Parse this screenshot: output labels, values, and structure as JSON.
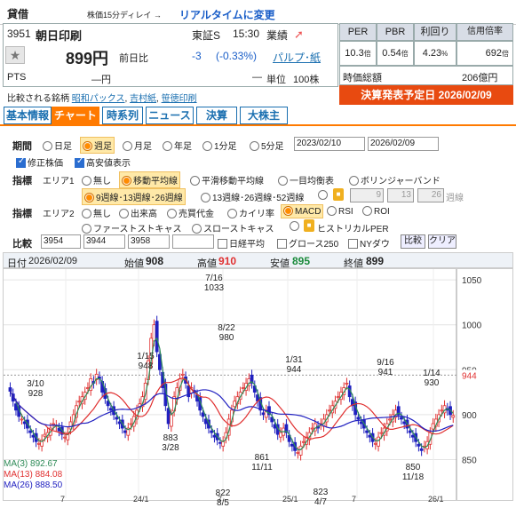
{
  "header": {
    "category": "貸借",
    "delay_note": "株価15分ディレイ →",
    "realtime_link": "リアルタイムに変更"
  },
  "stock": {
    "code": "3951",
    "name": "朝日印刷",
    "market": "東証S",
    "time": "15:30",
    "sector": "業績",
    "sector_link": "パルプ･紙",
    "price": "899円",
    "prev_label": "前日比",
    "change": "-3",
    "change_pct": "(-0.33%)",
    "pts_label": "PTS",
    "pts_value": "―円",
    "pts_change": "―",
    "unit_label": "単位",
    "unit_value": "100株"
  },
  "ratios": {
    "per_label": "PER",
    "per": "10.3",
    "per_unit": "倍",
    "pbr_label": "PBR",
    "pbr": "0.54",
    "pbr_unit": "倍",
    "yield_label": "利回り",
    "yield": "4.23",
    "yield_unit": "%",
    "margin_label": "信用倍率",
    "margin": "692",
    "margin_unit": "倍",
    "cap_label": "時価総額",
    "cap": "206億円",
    "earnings": "決算発表予定日 2026/02/09"
  },
  "compare": {
    "label": "比較される銘柄",
    "links": [
      "昭和パックス",
      "吉村紙",
      "笹徳印刷"
    ]
  },
  "tabs": [
    "基本情報",
    "チャート",
    "時系列",
    "ニュース",
    "決算",
    "大株主"
  ],
  "controls": {
    "period_label": "期間",
    "periods": [
      "日足",
      "週足",
      "月足",
      "年足",
      "1分足",
      "5分足"
    ],
    "date_from": "2023/02/10",
    "date_to": "2026/02/09",
    "adj_label": "修正株価",
    "hl_label": "高安値表示",
    "ind_label": "指標",
    "area1_label": "エリア1",
    "area1_opts": [
      "無し",
      "移動平均線",
      "平滑移動平均線",
      "一目均衡表",
      "ボリンジャーバンド"
    ],
    "ma_opts": [
      "9週線･13週線･26週線",
      "13週線･26週線･52週線"
    ],
    "ma_custom": [
      "9",
      "13",
      "26"
    ],
    "ma_custom_unit": "週線",
    "area2_label": "エリア2",
    "area2_opts": [
      "無し",
      "出来高",
      "売買代金",
      "カイリ率",
      "MACD",
      "RSI",
      "ROI"
    ],
    "area2_opts2": [
      "ファーストストキャス",
      "スローストキャス",
      "ヒストリカルPER"
    ],
    "cmp_label": "比較",
    "cmp_codes": [
      "3954",
      "3944",
      "3958",
      ""
    ],
    "cmp_opts": [
      "日経平均",
      "グロース250",
      "NYダウ"
    ],
    "cmp_btn": "比較",
    "clear_btn": "クリア"
  },
  "ohlc": {
    "date_label": "日付",
    "date": "2026/02/09",
    "open_label": "始値",
    "open": "908",
    "high_label": "高値",
    "high": "910",
    "low_label": "安値",
    "low": "895",
    "close_label": "終値",
    "close": "899"
  },
  "colors": {
    "accent": "#ff7a00",
    "link": "#1a6fb0",
    "up": "#e03030",
    "down": "#2020c0",
    "ma9": "#2e8b57",
    "ma13": "#e03030",
    "ma26": "#2020c0"
  },
  "chart_data": {
    "type": "candlestick",
    "x_ticks": [
      "7",
      "24/1",
      "7",
      "25/1",
      "7",
      "26/1"
    ],
    "y_ticks": [
      1050,
      1000,
      950,
      900,
      850
    ],
    "ylim": [
      805,
      1060
    ],
    "last_price": 944,
    "annotations": [
      {
        "date": "3/10",
        "value": 928
      },
      {
        "date": "1/15",
        "value": 948
      },
      {
        "date": "3/28",
        "value": 883
      },
      {
        "date": "7/16",
        "value": 1033
      },
      {
        "date": "8/22",
        "value": 980
      },
      {
        "date": "8/5",
        "value": 822
      },
      {
        "date": "11/11",
        "value": 861
      },
      {
        "date": "1/31",
        "value": 944
      },
      {
        "date": "4/7",
        "value": 823
      },
      {
        "date": "9/16",
        "value": 941
      },
      {
        "date": "11/18",
        "value": 850
      },
      {
        "date": "1/14",
        "value": 930
      }
    ],
    "ma_legend": [
      {
        "name": "MA(3)",
        "value": "892.67"
      },
      {
        "name": "MA(13)",
        "value": "884.08"
      },
      {
        "name": "MA(26)",
        "value": "888.50"
      }
    ],
    "weekly_close": [
      926,
      915,
      905,
      898,
      895,
      890,
      885,
      880,
      875,
      870,
      868,
      872,
      878,
      880,
      885,
      890,
      888,
      882,
      878,
      875,
      880,
      892,
      900,
      910,
      915,
      920,
      925,
      930,
      940,
      935,
      945,
      940,
      925,
      918,
      910,
      905,
      900,
      895,
      890,
      885,
      880,
      885,
      890,
      898,
      905,
      912,
      920,
      935,
      960,
      985,
      1000,
      970,
      950,
      930,
      910,
      890,
      900,
      920,
      930,
      940,
      945,
      935,
      920,
      930,
      925,
      915,
      905,
      898,
      890,
      885,
      880,
      875,
      872,
      868,
      870,
      880,
      895,
      905,
      915,
      920,
      925,
      930,
      935,
      940,
      935,
      925,
      915,
      905,
      900,
      905,
      900,
      892,
      885,
      878,
      880,
      885,
      880,
      870,
      865,
      860,
      858,
      865,
      870,
      875,
      880,
      885,
      890,
      885,
      890,
      895,
      900,
      905,
      910,
      915,
      920,
      925,
      930,
      935,
      920,
      910,
      900,
      895,
      890,
      885,
      880,
      875,
      870,
      868,
      875,
      880,
      885,
      890,
      895,
      900,
      905,
      900,
      895,
      890,
      885,
      880,
      875,
      870,
      865,
      860,
      865,
      870,
      880,
      890,
      895,
      900,
      905,
      910,
      905,
      900,
      899
    ]
  }
}
